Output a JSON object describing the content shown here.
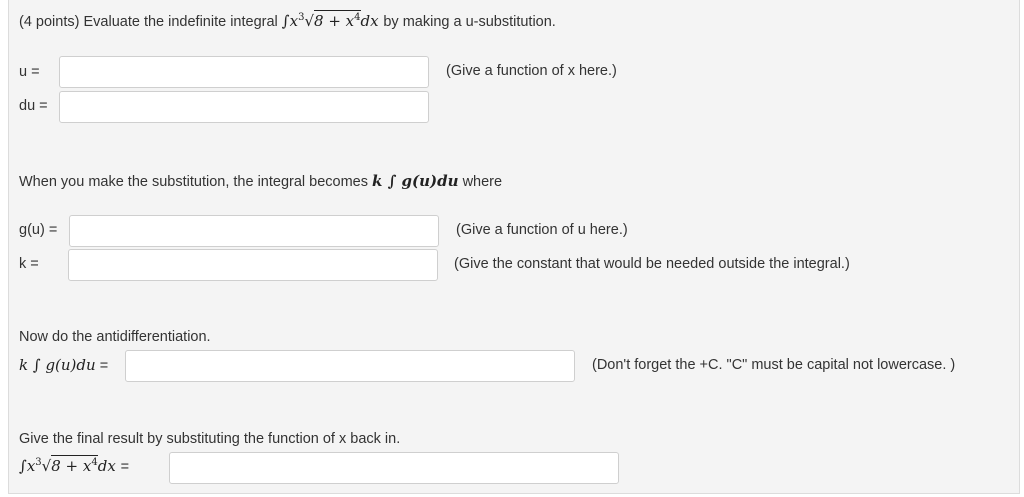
{
  "header": {
    "points": "(4 points)",
    "prompt": "Evaluate the indefinite integral",
    "integrand_int": "∫",
    "integrand_x": "x",
    "integrand_exp3": "3",
    "integrand_sqrt": "√",
    "integrand_radicand": "8 + x",
    "integrand_exp4": "4",
    "integrand_dx": "dx",
    "suffix": "by making a u-substitution."
  },
  "u_row": {
    "label": "u =",
    "value": "",
    "hint": "(Give a function of x here.)"
  },
  "du_row": {
    "label": "du =",
    "value": ""
  },
  "substitution_text": {
    "before": "When you make the substitution, the integral becomes",
    "expr": "k ∫ g(u)du",
    "after": "where"
  },
  "g_row": {
    "label": "g(u) =",
    "value": "",
    "hint": "(Give a function of u here.)"
  },
  "k_row": {
    "label": "k =",
    "value": "",
    "hint": "(Give the constant that would be needed outside the integral.)"
  },
  "antidiff": {
    "title": "Now do the antidifferentiation.",
    "expr": "k ∫ g(u)du",
    "eq": "=",
    "value": "",
    "hint": "(Don't forget the +C. \"C\" must be capital not lowercase. )"
  },
  "final": {
    "title": "Give the final result by substituting the function of x back in.",
    "eq": "=",
    "value": ""
  }
}
